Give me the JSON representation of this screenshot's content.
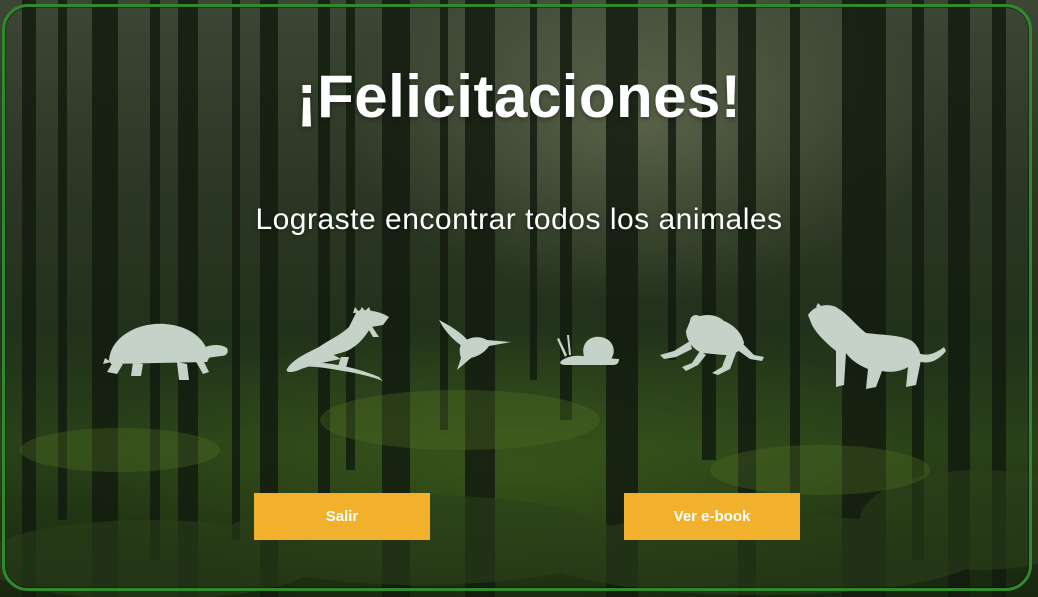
{
  "dialog": {
    "title": "¡Felicitaciones!",
    "message": "Lograste encontrar todos los animales"
  },
  "animals": [
    {
      "name": "turtle-icon"
    },
    {
      "name": "iguana-icon"
    },
    {
      "name": "hummingbird-icon"
    },
    {
      "name": "snail-icon"
    },
    {
      "name": "frog-icon"
    },
    {
      "name": "jaguar-icon"
    }
  ],
  "buttons": {
    "exit_label": "Salir",
    "ebook_label": "Ver e-book"
  },
  "colors": {
    "frame_border": "#2f8a2c",
    "button_bg": "#f2b12d",
    "button_text": "#ffffff",
    "silhouette": "#c5d2c7",
    "title_text": "#ffffff"
  }
}
